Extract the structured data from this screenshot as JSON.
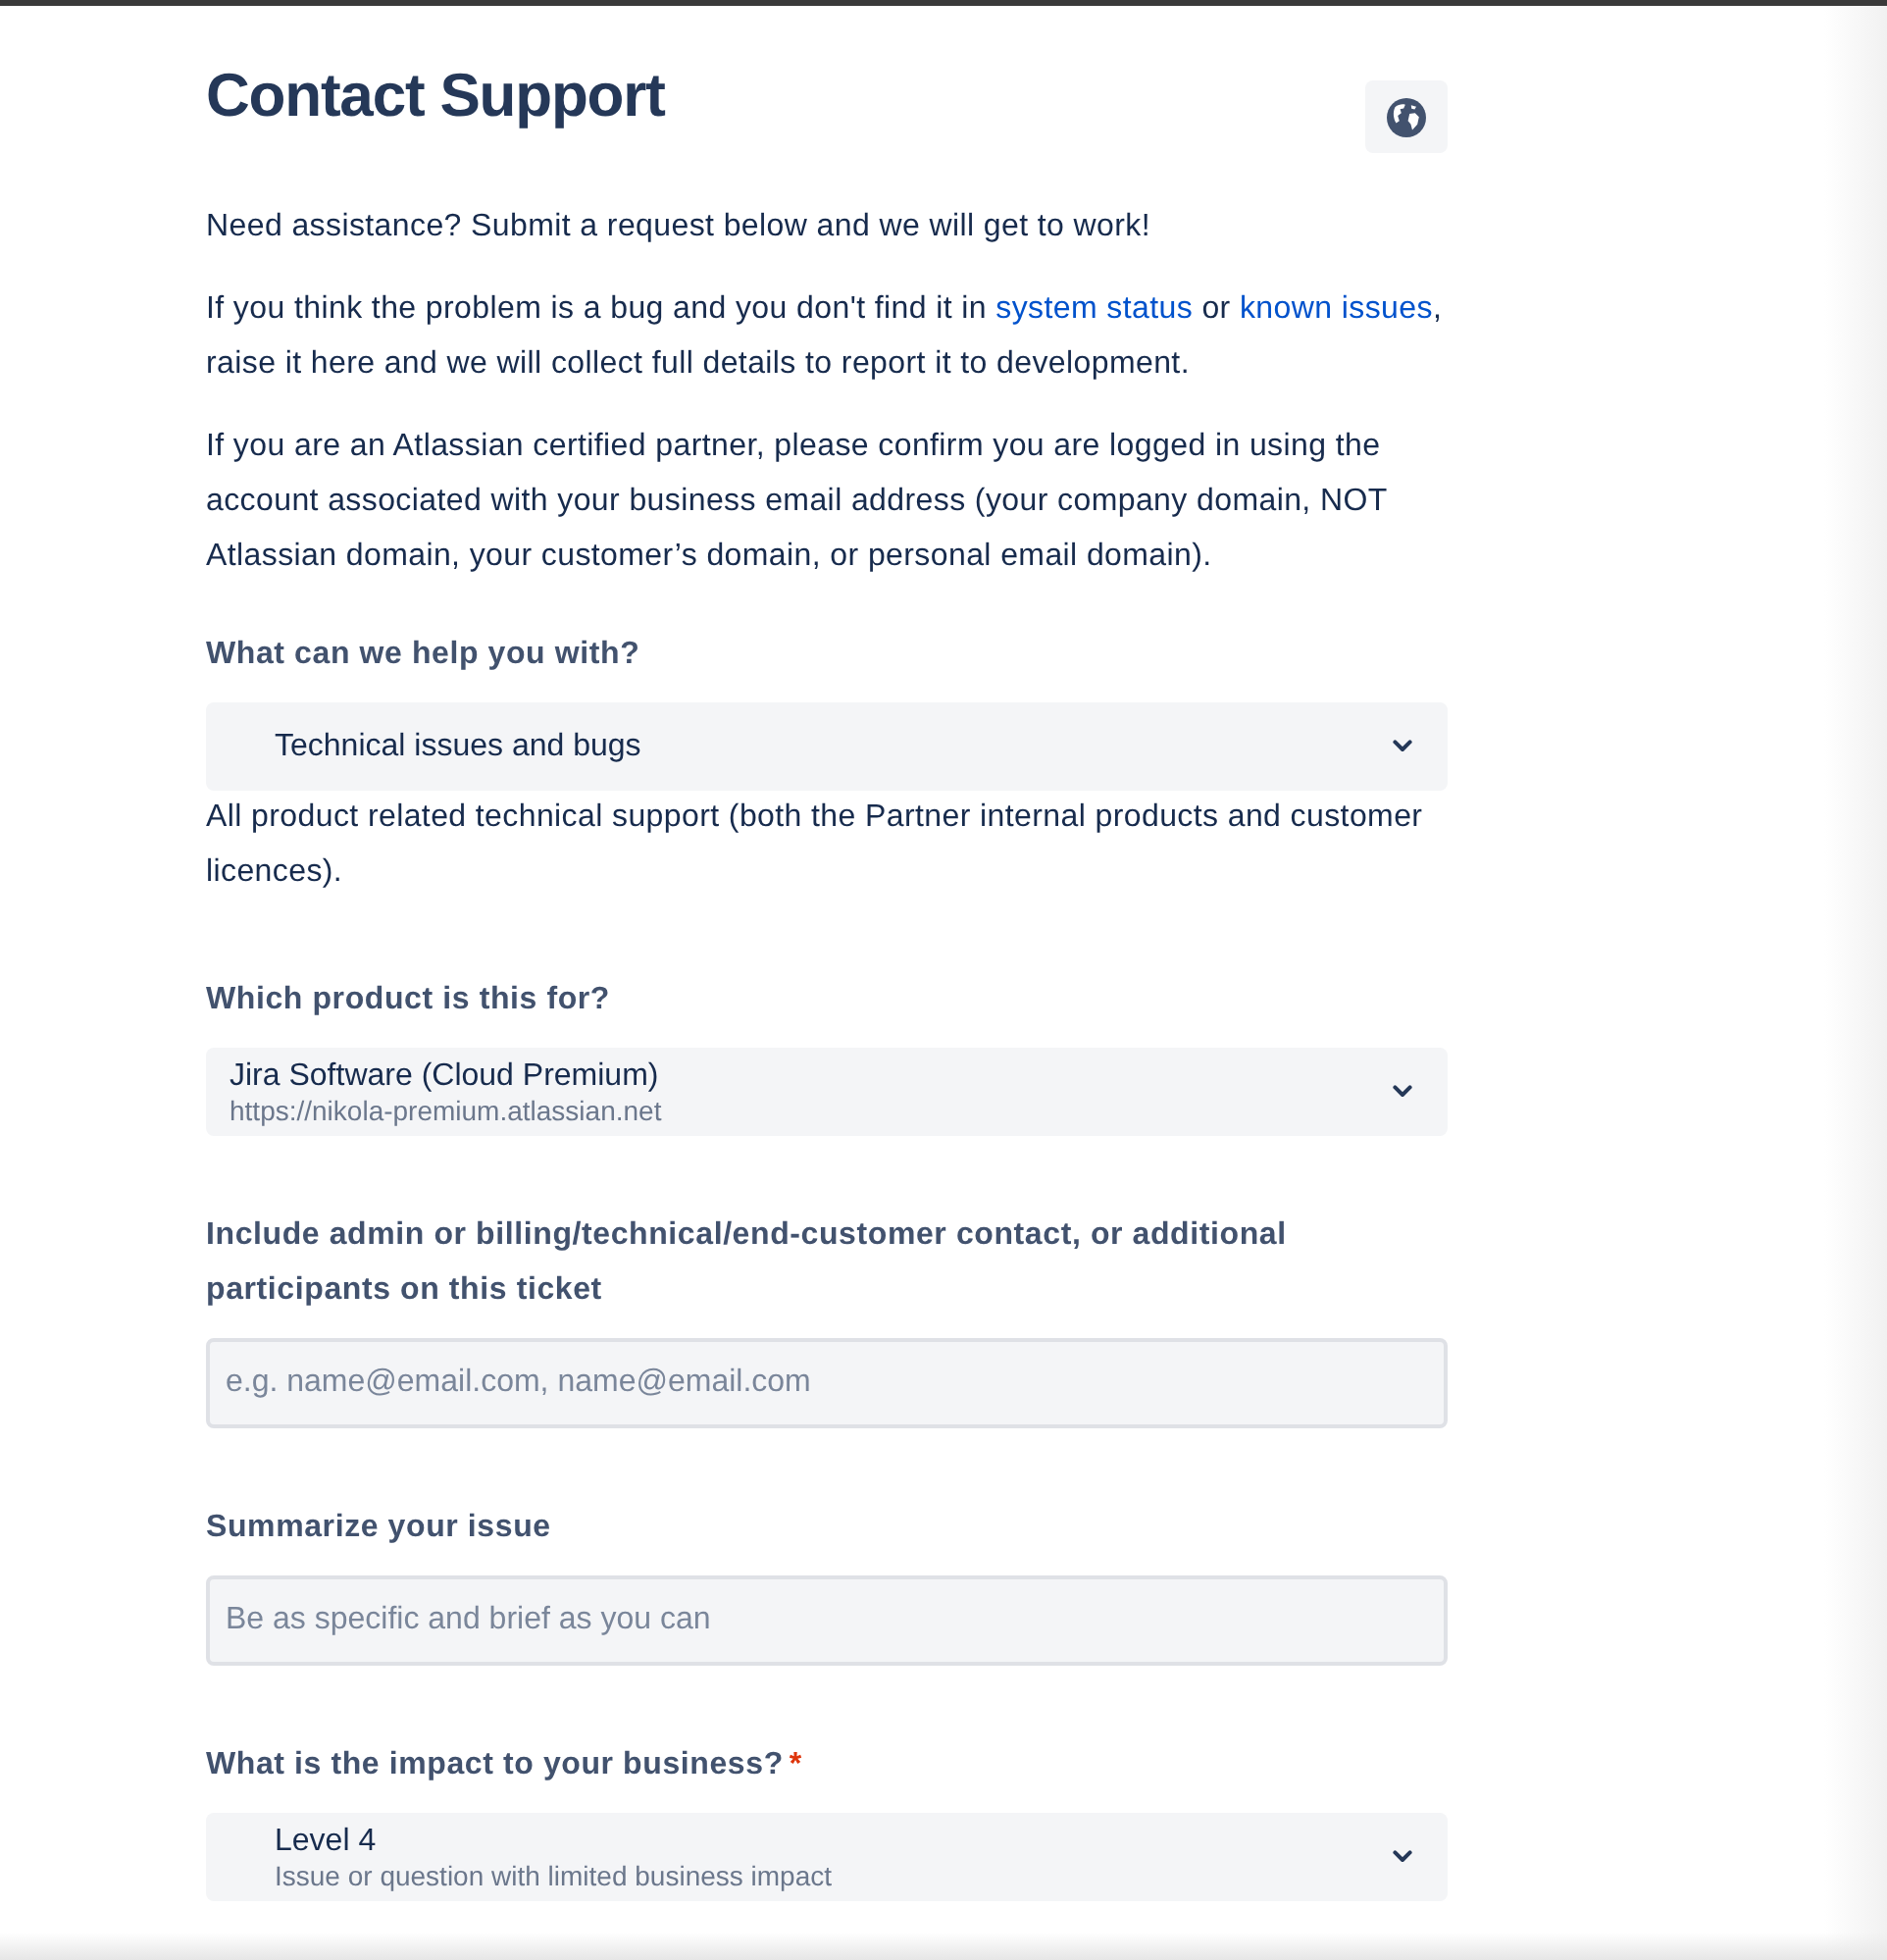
{
  "page": {
    "title": "Contact Support"
  },
  "intro": [
    {
      "segments": [
        {
          "kind": "text",
          "text": "Need assistance? Submit a request below and we will get to work!"
        }
      ]
    },
    {
      "segments": [
        {
          "kind": "text",
          "text": "If you think the problem is a bug and you don't find it in "
        },
        {
          "kind": "link",
          "text": "system status"
        },
        {
          "kind": "text",
          "text": " or "
        },
        {
          "kind": "link",
          "text": "known issues"
        },
        {
          "kind": "text",
          "text": ", raise it here and we will collect full details to report it to development."
        }
      ]
    },
    {
      "segments": [
        {
          "kind": "text",
          "text": "If you are an Atlassian certified partner, please confirm you are logged in using the account associated with your business email address (your company domain, NOT Atlassian domain, your customer’s domain, or personal email domain)."
        }
      ]
    }
  ],
  "fields": [
    {
      "kind": "icon-select",
      "label": "What can we help you with?",
      "value": "Technical issues and bugs",
      "help": "All product related technical support (both the Partner internal products and customer licences)."
    },
    {
      "kind": "select",
      "label": "Which product is this for?",
      "value": "Jira Software (Cloud Premium)",
      "description": "https://nikola-premium.atlassian.net"
    },
    {
      "kind": "input",
      "label": "Include admin or billing/technical/end-customer contact, or additional participants on this ticket",
      "placeholder": "e.g. name@email.com, name@email.com"
    },
    {
      "kind": "input",
      "label": "Summarize your issue",
      "placeholder": "Be as specific and brief as you can"
    },
    {
      "kind": "icon-select",
      "label": "What is the impact to your business?",
      "required_mark": "*",
      "value": "Level 4",
      "description": "Issue or question with limited business impact"
    }
  ]
}
